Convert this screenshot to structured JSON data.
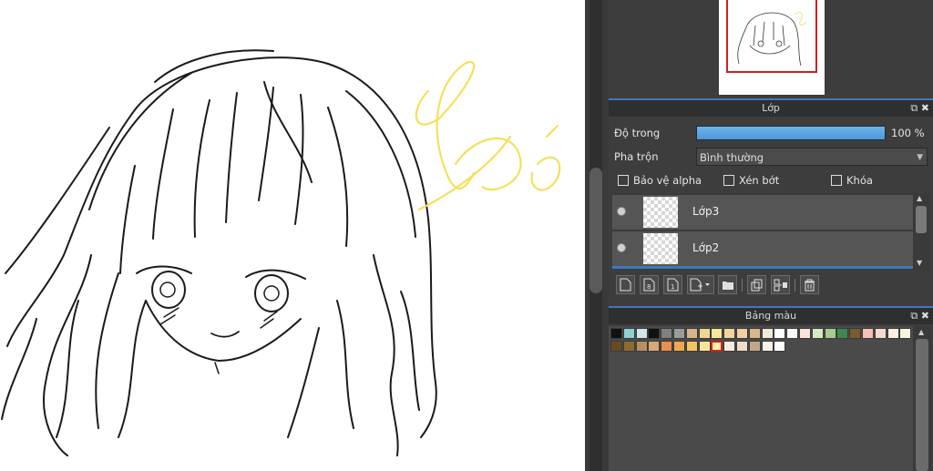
{
  "canvas": {
    "artwork_description_icon": "sketch-drawing",
    "stroke_color": "#1a1a1a",
    "highlight_color": "#f5e05a"
  },
  "layer_panel": {
    "title": "Lớp",
    "opacity_label": "Độ trong",
    "opacity_value": "100 %",
    "opacity_fraction": 1.0,
    "blend_label": "Pha trộn",
    "blend_value": "Bình thường",
    "checkbox_alpha": "Bảo vệ alpha",
    "checkbox_clip": "Xén bớt",
    "checkbox_lock": "Khóa",
    "layers": [
      {
        "name": "Lớp3"
      },
      {
        "name": "Lớp2"
      }
    ],
    "accent_color": "#3e78c0"
  },
  "palette_panel": {
    "title": "Bảng màu",
    "row1": [
      "#111111",
      "#8ed0d8",
      "#cfe6ec",
      "#111111",
      "#808080",
      "#9c9c9c",
      "#d8b48c",
      "#f0d890",
      "#f8e89c",
      "#f4d49c",
      "#f0d0a0",
      "#d8b88c",
      "#f0ead8",
      "#ffffff",
      "#f8f8f8",
      "#fce4d8",
      "#d8e8c0",
      "#a8cc90",
      "#3c8850",
      "#7c5a30",
      "#f4c0b0",
      "#f8d8cc",
      "#fcf0e4",
      "#f8f4e0"
    ],
    "row2": [
      "#6a4a20",
      "#8c6a30",
      "#b89060",
      "#d8a878",
      "#e8904c",
      "#f0a850",
      "#f4c460",
      "#f8e498",
      "#fcf0a8",
      "#f8ece0",
      "#f0dcc8",
      "#c0a888",
      "#fcf0e8",
      "#ffffff"
    ],
    "selected_index_row2": 8
  }
}
